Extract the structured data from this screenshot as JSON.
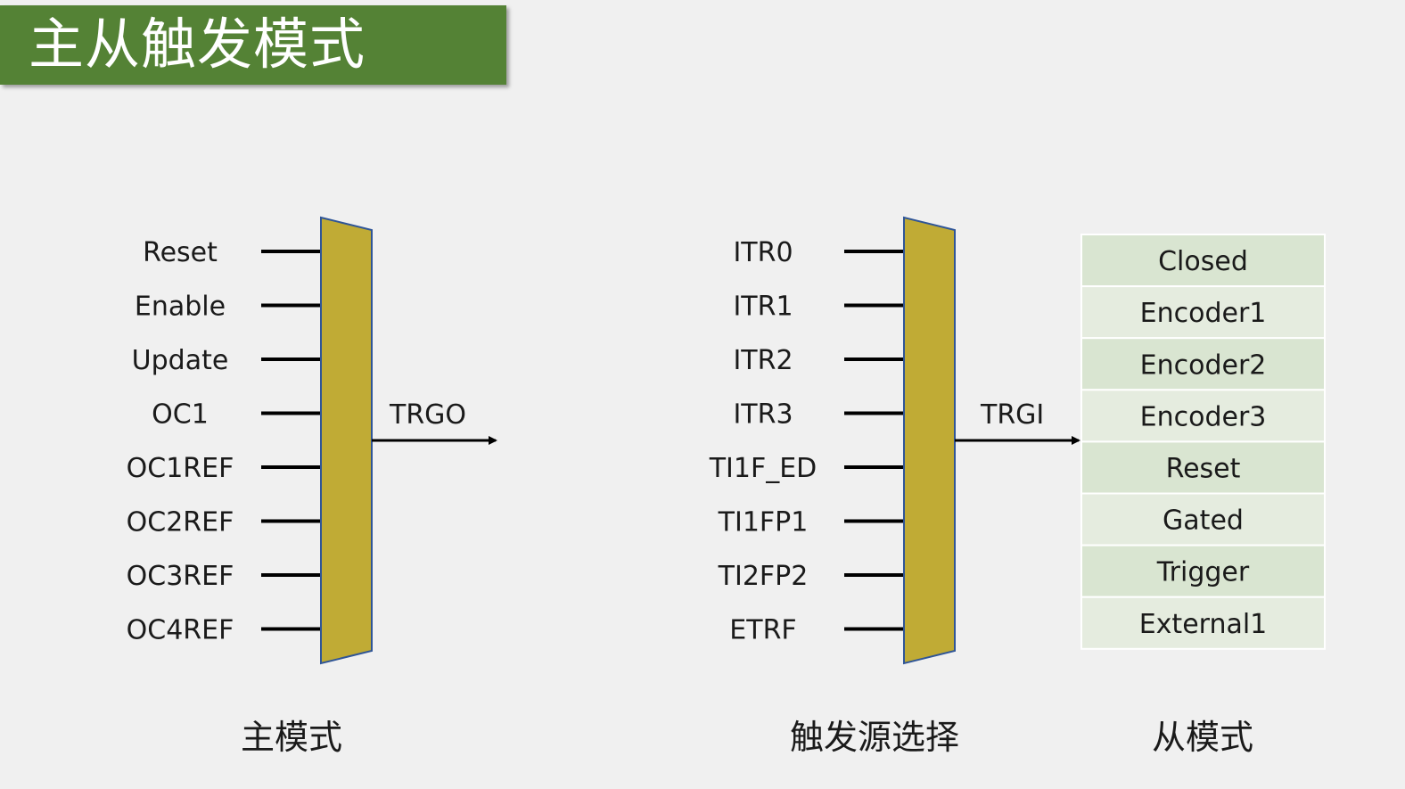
{
  "title": "主从触发模式",
  "colors": {
    "title_bg": "#548235",
    "mux_fill": "#c0ab35",
    "mux_stroke": "#2f5597",
    "mode_cell_dark": "#d9e5d1",
    "mode_cell_light": "#e5ecdf",
    "line": "#000000"
  },
  "master": {
    "inputs": [
      "Reset",
      "Enable",
      "Update",
      "OC1",
      "OC1REF",
      "OC2REF",
      "OC3REF",
      "OC4REF"
    ],
    "output": "TRGO",
    "caption": "主模式"
  },
  "trigger_select": {
    "inputs": [
      "ITR0",
      "ITR1",
      "ITR2",
      "ITR3",
      "TI1F_ED",
      "TI1FP1",
      "TI2FP2",
      "ETRF"
    ],
    "output": "TRGI",
    "caption": "触发源选择"
  },
  "slave": {
    "modes": [
      "Closed",
      "Encoder1",
      "Encoder2",
      "Encoder3",
      "Reset",
      "Gated",
      "Trigger",
      "External1"
    ],
    "caption": "从模式"
  }
}
